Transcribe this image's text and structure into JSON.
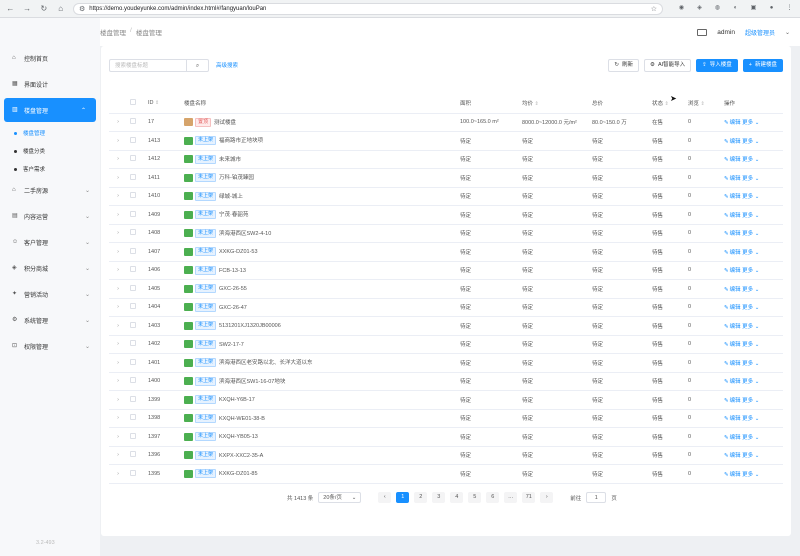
{
  "browser": {
    "url": "https://demo.youdeyunke.com/admin/index.html#/fangyuan/louPan"
  },
  "sidebar": {
    "version": "3.2-493",
    "items": [
      {
        "icon": "home-icon",
        "label": "控制首页",
        "expandable": false
      },
      {
        "icon": "design-icon",
        "label": "界面设计",
        "expandable": false
      },
      {
        "icon": "building-icon",
        "label": "楼盘管理",
        "expandable": true,
        "active": true,
        "children": [
          {
            "label": "楼盘管理",
            "active": true
          },
          {
            "label": "楼盘分类",
            "active": false
          },
          {
            "label": "客户需求",
            "active": false
          }
        ]
      },
      {
        "icon": "house-icon",
        "label": "二手房源",
        "expandable": true
      },
      {
        "icon": "content-icon",
        "label": "内容运营",
        "expandable": true
      },
      {
        "icon": "customer-icon",
        "label": "客户管理",
        "expandable": true
      },
      {
        "icon": "points-icon",
        "label": "积分商城",
        "expandable": true
      },
      {
        "icon": "marketing-icon",
        "label": "营销活动",
        "expandable": true
      },
      {
        "icon": "settings-icon",
        "label": "系统管理",
        "expandable": true
      },
      {
        "icon": "lock-icon",
        "label": "权限管理",
        "expandable": true
      }
    ]
  },
  "header": {
    "breadcrumb": [
      "楼盘管理",
      "楼盘管理"
    ],
    "user": "admin",
    "role": "超级管理员"
  },
  "toolbar": {
    "search_placeholder": "搜索楼盘标题",
    "advanced_search": "高级搜索",
    "refresh": "刷新",
    "ai_import": "AI智能导入",
    "import_label": "导入楼盘",
    "new_label": "新建楼盘"
  },
  "table": {
    "columns": [
      "ID",
      "楼盘名称",
      "面积",
      "均价",
      "总价",
      "状态",
      "浏览",
      "操作"
    ],
    "edit_label": "编辑",
    "more_label": "更多",
    "rows": [
      {
        "id": "17",
        "tag": "置顶",
        "tag_color": "red",
        "thumb": "#d6a46b",
        "name": "测试楼盘",
        "area": "100.0~165.0 m²",
        "price": "8000.0~12000.0 元/m²",
        "total": "80.0~150.0 万",
        "status": "在售",
        "views": "0"
      },
      {
        "id": "1413",
        "tag": "未上架",
        "tag_color": "blue",
        "thumb": "#4caf50",
        "name": "福商路市正地块项",
        "area": "待定",
        "price": "待定",
        "total": "待定",
        "status": "待售",
        "views": "0"
      },
      {
        "id": "1412",
        "tag": "未上架",
        "tag_color": "blue",
        "thumb": "#4caf50",
        "name": "未来城市",
        "area": "待定",
        "price": "待定",
        "total": "待定",
        "status": "待售",
        "views": "0"
      },
      {
        "id": "1411",
        "tag": "未上架",
        "tag_color": "blue",
        "thumb": "#4caf50",
        "name": "万科-铂茂臻园",
        "area": "待定",
        "price": "待定",
        "total": "待定",
        "status": "待售",
        "views": "0"
      },
      {
        "id": "1410",
        "tag": "未上架",
        "tag_color": "blue",
        "thumb": "#4caf50",
        "name": "绿城-城上",
        "area": "待定",
        "price": "待定",
        "total": "待定",
        "status": "待售",
        "views": "0"
      },
      {
        "id": "1409",
        "tag": "未上架",
        "tag_color": "blue",
        "thumb": "#4caf50",
        "name": "宁茂·春韶苑",
        "area": "待定",
        "price": "待定",
        "total": "待定",
        "status": "待售",
        "views": "0"
      },
      {
        "id": "1408",
        "tag": "未上架",
        "tag_color": "blue",
        "thumb": "#4caf50",
        "name": "滨海港西区SW2-4-10",
        "area": "待定",
        "price": "待定",
        "total": "待定",
        "status": "待售",
        "views": "0"
      },
      {
        "id": "1407",
        "tag": "未上架",
        "tag_color": "blue",
        "thumb": "#4caf50",
        "name": "XXKG-DZ01-53",
        "area": "待定",
        "price": "待定",
        "total": "待定",
        "status": "待售",
        "views": "0"
      },
      {
        "id": "1406",
        "tag": "未上架",
        "tag_color": "blue",
        "thumb": "#4caf50",
        "name": "FCB-13-13",
        "area": "待定",
        "price": "待定",
        "total": "待定",
        "status": "待售",
        "views": "0"
      },
      {
        "id": "1405",
        "tag": "未上架",
        "tag_color": "blue",
        "thumb": "#4caf50",
        "name": "GXC-26-55",
        "area": "待定",
        "price": "待定",
        "total": "待定",
        "status": "待售",
        "views": "0"
      },
      {
        "id": "1404",
        "tag": "未上架",
        "tag_color": "blue",
        "thumb": "#4caf50",
        "name": "GXC-26-47",
        "area": "待定",
        "price": "待定",
        "total": "待定",
        "status": "待售",
        "views": "0"
      },
      {
        "id": "1403",
        "tag": "未上架",
        "tag_color": "blue",
        "thumb": "#4caf50",
        "name": "5131201XJ1320JB00006",
        "area": "待定",
        "price": "待定",
        "total": "待定",
        "status": "待售",
        "views": "0"
      },
      {
        "id": "1402",
        "tag": "未上架",
        "tag_color": "blue",
        "thumb": "#4caf50",
        "name": "SW2-17-7",
        "area": "待定",
        "price": "待定",
        "total": "待定",
        "status": "待售",
        "views": "0"
      },
      {
        "id": "1401",
        "tag": "未上架",
        "tag_color": "blue",
        "thumb": "#4caf50",
        "name": "滨海港西区老安路以北、长洋大道以东",
        "area": "待定",
        "price": "待定",
        "total": "待定",
        "status": "待售",
        "views": "0"
      },
      {
        "id": "1400",
        "tag": "未上架",
        "tag_color": "blue",
        "thumb": "#4caf50",
        "name": "滨海港西区SW1-16-07地块",
        "area": "待定",
        "price": "待定",
        "total": "待定",
        "status": "待售",
        "views": "0"
      },
      {
        "id": "1399",
        "tag": "未上架",
        "tag_color": "blue",
        "thumb": "#4caf50",
        "name": "KXQH-Y6B-17",
        "area": "待定",
        "price": "待定",
        "total": "待定",
        "status": "待售",
        "views": "0"
      },
      {
        "id": "1398",
        "tag": "未上架",
        "tag_color": "blue",
        "thumb": "#4caf50",
        "name": "KXQH-WE01-38-B",
        "area": "待定",
        "price": "待定",
        "total": "待定",
        "status": "待售",
        "views": "0"
      },
      {
        "id": "1397",
        "tag": "未上架",
        "tag_color": "blue",
        "thumb": "#4caf50",
        "name": "KXQH-YB05-13",
        "area": "待定",
        "price": "待定",
        "total": "待定",
        "status": "待售",
        "views": "0"
      },
      {
        "id": "1396",
        "tag": "未上架",
        "tag_color": "blue",
        "thumb": "#4caf50",
        "name": "KXPX-XXC2-35-A",
        "area": "待定",
        "price": "待定",
        "total": "待定",
        "status": "待售",
        "views": "0"
      },
      {
        "id": "1395",
        "tag": "未上架",
        "tag_color": "blue",
        "thumb": "#4caf50",
        "name": "KXKG-DZ01-85",
        "area": "待定",
        "price": "待定",
        "total": "待定",
        "status": "待售",
        "views": "0"
      }
    ]
  },
  "pagination": {
    "total": "共 1413 条",
    "page_size": "20条/页",
    "pages": [
      "1",
      "2",
      "3",
      "4",
      "5",
      "6",
      "…",
      "71"
    ],
    "current": "1",
    "goto_label": "前往",
    "goto_value": "1",
    "goto_suffix": "页"
  }
}
